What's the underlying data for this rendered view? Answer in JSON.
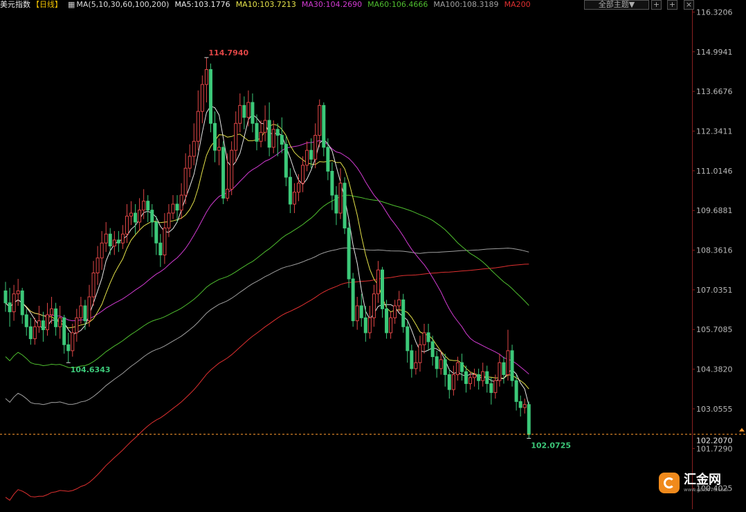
{
  "header": {
    "title": "美元指数",
    "period": "【日线】",
    "ma_label": "MA(5,10,30,60,100,200)",
    "ma5": "MA5:103.1776",
    "ma10": "MA10:103.7213",
    "ma30": "MA30:104.2690",
    "ma60": "MA60:106.4666",
    "ma100": "MA100:108.3189",
    "ma200": "MA200"
  },
  "toolbar": {
    "theme_label": "全部主题▼"
  },
  "logo": {
    "name": "汇金网",
    "url": "www.gold678.com"
  },
  "colors": {
    "up": "#e04646",
    "down": "#3cc879",
    "ma5": "#e8e8e8",
    "ma10": "#e6e34a",
    "ma30": "#d23bd2",
    "ma60": "#4fbf2f",
    "ma100": "#a0a0a0",
    "ma200": "#e03030",
    "price_line": "#ff9a2e"
  },
  "chart_data": {
    "type": "candlestick",
    "title": "美元指数",
    "period": "日线",
    "y_ticks": [
      "116.3206",
      "114.9941",
      "113.6676",
      "112.3411",
      "111.0146",
      "109.6881",
      "108.3616",
      "107.0351",
      "105.7085",
      "104.3820",
      "103.0555",
      "101.7290",
      "100.4025"
    ],
    "ylim": [
      99.7,
      116.4
    ],
    "current_price": "102.2070",
    "annotations": {
      "high": "114.7940",
      "low": "104.6343",
      "last_low": "102.0725"
    },
    "candles": [
      [
        107.0,
        106.6,
        107.3,
        106.3
      ],
      [
        106.6,
        106.3,
        107.1,
        105.8
      ],
      [
        106.3,
        106.9,
        107.2,
        106.0
      ],
      [
        106.9,
        107.0,
        107.4,
        106.5
      ],
      [
        107.0,
        106.2,
        107.1,
        105.9
      ],
      [
        106.2,
        105.8,
        106.4,
        105.5
      ],
      [
        105.8,
        105.4,
        106.1,
        105.2
      ],
      [
        105.4,
        105.8,
        106.1,
        105.2
      ],
      [
        105.8,
        106.0,
        106.5,
        105.6
      ],
      [
        106.0,
        105.7,
        106.3,
        105.3
      ],
      [
        105.7,
        106.2,
        106.6,
        105.5
      ],
      [
        106.2,
        106.4,
        106.8,
        105.9
      ],
      [
        106.4,
        105.8,
        106.6,
        105.5
      ],
      [
        105.8,
        106.1,
        106.5,
        105.4
      ],
      [
        106.1,
        105.2,
        106.2,
        104.9
      ],
      [
        105.2,
        105.0,
        105.6,
        104.6
      ],
      [
        105.0,
        105.6,
        105.9,
        104.8
      ],
      [
        105.6,
        106.1,
        106.4,
        105.3
      ],
      [
        106.1,
        106.5,
        106.8,
        105.9
      ],
      [
        106.5,
        106.0,
        106.7,
        105.7
      ],
      [
        106.0,
        106.8,
        107.2,
        105.8
      ],
      [
        106.8,
        107.6,
        108.0,
        106.5
      ],
      [
        107.6,
        108.1,
        108.5,
        107.2
      ],
      [
        108.1,
        108.6,
        109.0,
        107.7
      ],
      [
        108.6,
        108.9,
        109.3,
        108.3
      ],
      [
        108.9,
        108.5,
        109.1,
        108.2
      ],
      [
        108.5,
        108.7,
        109.0,
        108.2
      ],
      [
        108.7,
        108.6,
        109.0,
        108.3
      ],
      [
        108.6,
        108.9,
        109.2,
        108.4
      ],
      [
        108.9,
        109.5,
        109.9,
        108.6
      ],
      [
        109.5,
        109.6,
        110.0,
        109.2
      ],
      [
        109.6,
        109.3,
        109.9,
        108.9
      ],
      [
        109.3,
        109.7,
        110.1,
        109.0
      ],
      [
        109.7,
        110.0,
        110.4,
        109.4
      ],
      [
        110.0,
        109.7,
        110.2,
        109.3
      ],
      [
        109.7,
        109.3,
        109.9,
        108.8
      ],
      [
        109.3,
        108.6,
        109.5,
        108.2
      ],
      [
        108.6,
        108.2,
        108.9,
        107.8
      ],
      [
        108.2,
        109.1,
        109.6,
        107.9
      ],
      [
        109.1,
        109.6,
        109.9,
        108.8
      ],
      [
        109.6,
        109.9,
        110.2,
        109.4
      ],
      [
        109.9,
        109.7,
        110.2,
        109.3
      ],
      [
        109.7,
        110.2,
        110.6,
        109.4
      ],
      [
        110.2,
        111.1,
        111.6,
        109.9
      ],
      [
        111.1,
        111.5,
        111.9,
        110.8
      ],
      [
        111.5,
        112.0,
        112.6,
        111.2
      ],
      [
        112.0,
        113.0,
        113.7,
        111.7
      ],
      [
        113.0,
        113.9,
        114.2,
        112.6
      ],
      [
        113.9,
        114.4,
        114.8,
        113.3
      ],
      [
        114.4,
        112.6,
        114.6,
        112.3
      ],
      [
        112.6,
        111.7,
        113.0,
        111.3
      ],
      [
        111.7,
        111.8,
        112.1,
        111.2
      ],
      [
        111.8,
        110.1,
        112.0,
        109.9
      ],
      [
        110.1,
        110.4,
        111.6,
        110.0
      ],
      [
        110.4,
        111.7,
        112.0,
        110.2
      ],
      [
        111.7,
        112.6,
        113.0,
        111.3
      ],
      [
        112.6,
        113.2,
        113.6,
        112.3
      ],
      [
        113.2,
        112.8,
        113.5,
        112.4
      ],
      [
        112.8,
        113.3,
        113.7,
        112.5
      ],
      [
        113.3,
        112.6,
        113.6,
        112.3
      ],
      [
        112.6,
        112.0,
        112.9,
        111.7
      ],
      [
        112.0,
        112.3,
        112.7,
        111.8
      ],
      [
        112.3,
        112.7,
        113.2,
        112.0
      ],
      [
        112.7,
        111.8,
        113.3,
        111.5
      ],
      [
        111.8,
        112.4,
        112.7,
        111.6
      ],
      [
        112.4,
        112.2,
        112.6,
        111.5
      ],
      [
        112.2,
        111.9,
        112.8,
        111.6
      ],
      [
        111.9,
        110.8,
        112.2,
        110.5
      ],
      [
        110.8,
        109.9,
        111.1,
        109.6
      ],
      [
        109.9,
        110.3,
        110.6,
        109.6
      ],
      [
        110.3,
        110.6,
        110.9,
        110.0
      ],
      [
        110.6,
        111.2,
        111.5,
        110.3
      ],
      [
        111.2,
        111.7,
        112.0,
        111.0
      ],
      [
        111.7,
        111.4,
        112.1,
        111.1
      ],
      [
        111.4,
        112.2,
        112.6,
        111.1
      ],
      [
        112.2,
        113.2,
        113.4,
        111.8
      ],
      [
        113.2,
        111.8,
        113.3,
        111.5
      ],
      [
        111.8,
        111.0,
        112.1,
        110.7
      ],
      [
        111.0,
        110.2,
        111.3,
        109.7
      ],
      [
        110.2,
        109.6,
        110.5,
        109.2
      ],
      [
        109.6,
        110.6,
        111.1,
        109.4
      ],
      [
        110.6,
        109.1,
        110.8,
        108.9
      ],
      [
        109.1,
        107.4,
        109.3,
        107.1
      ],
      [
        107.4,
        106.0,
        107.6,
        105.8
      ],
      [
        106.0,
        106.5,
        106.8,
        105.7
      ],
      [
        106.5,
        106.1,
        106.9,
        105.8
      ],
      [
        106.1,
        105.6,
        106.5,
        105.3
      ],
      [
        105.6,
        106.1,
        106.5,
        105.4
      ],
      [
        106.1,
        106.9,
        107.2,
        105.8
      ],
      [
        106.9,
        107.7,
        108.0,
        106.6
      ],
      [
        107.7,
        106.4,
        107.8,
        106.1
      ],
      [
        106.4,
        105.6,
        106.7,
        105.4
      ],
      [
        105.6,
        106.1,
        106.3,
        105.4
      ],
      [
        106.1,
        106.5,
        106.7,
        105.9
      ],
      [
        106.5,
        106.7,
        107.0,
        106.3
      ],
      [
        106.7,
        105.8,
        106.9,
        105.6
      ],
      [
        105.8,
        105.0,
        106.0,
        104.6
      ],
      [
        105.0,
        104.4,
        105.2,
        104.1
      ],
      [
        104.4,
        104.6,
        105.0,
        104.2
      ],
      [
        104.6,
        105.2,
        105.5,
        104.3
      ],
      [
        105.2,
        105.6,
        105.9,
        104.9
      ],
      [
        105.6,
        105.3,
        105.9,
        105.0
      ],
      [
        105.3,
        104.8,
        105.5,
        104.5
      ],
      [
        104.8,
        104.4,
        105.0,
        104.1
      ],
      [
        104.4,
        104.7,
        105.0,
        104.2
      ],
      [
        104.7,
        104.2,
        104.9,
        103.8
      ],
      [
        104.2,
        103.7,
        104.4,
        103.4
      ],
      [
        103.7,
        104.2,
        104.5,
        103.5
      ],
      [
        104.2,
        104.6,
        104.8,
        104.0
      ],
      [
        104.6,
        104.3,
        104.9,
        104.0
      ],
      [
        104.3,
        103.9,
        104.5,
        103.6
      ],
      [
        103.9,
        104.1,
        104.3,
        103.7
      ],
      [
        104.1,
        104.2,
        104.4,
        103.8
      ],
      [
        104.2,
        104.0,
        104.4,
        103.7
      ],
      [
        104.0,
        104.3,
        104.6,
        103.8
      ],
      [
        104.3,
        103.9,
        104.5,
        103.6
      ],
      [
        103.9,
        103.6,
        104.1,
        103.2
      ],
      [
        103.6,
        104.0,
        104.2,
        103.4
      ],
      [
        104.0,
        104.6,
        104.9,
        103.8
      ],
      [
        104.6,
        104.2,
        104.8,
        103.9
      ],
      [
        104.2,
        105.0,
        105.7,
        104.0
      ],
      [
        105.0,
        104.0,
        105.2,
        103.8
      ],
      [
        104.0,
        103.3,
        104.2,
        103.0
      ],
      [
        103.3,
        103.1,
        103.5,
        102.8
      ],
      [
        103.1,
        103.2,
        103.4,
        102.9
      ],
      [
        103.2,
        102.2,
        103.3,
        102.07
      ]
    ]
  }
}
